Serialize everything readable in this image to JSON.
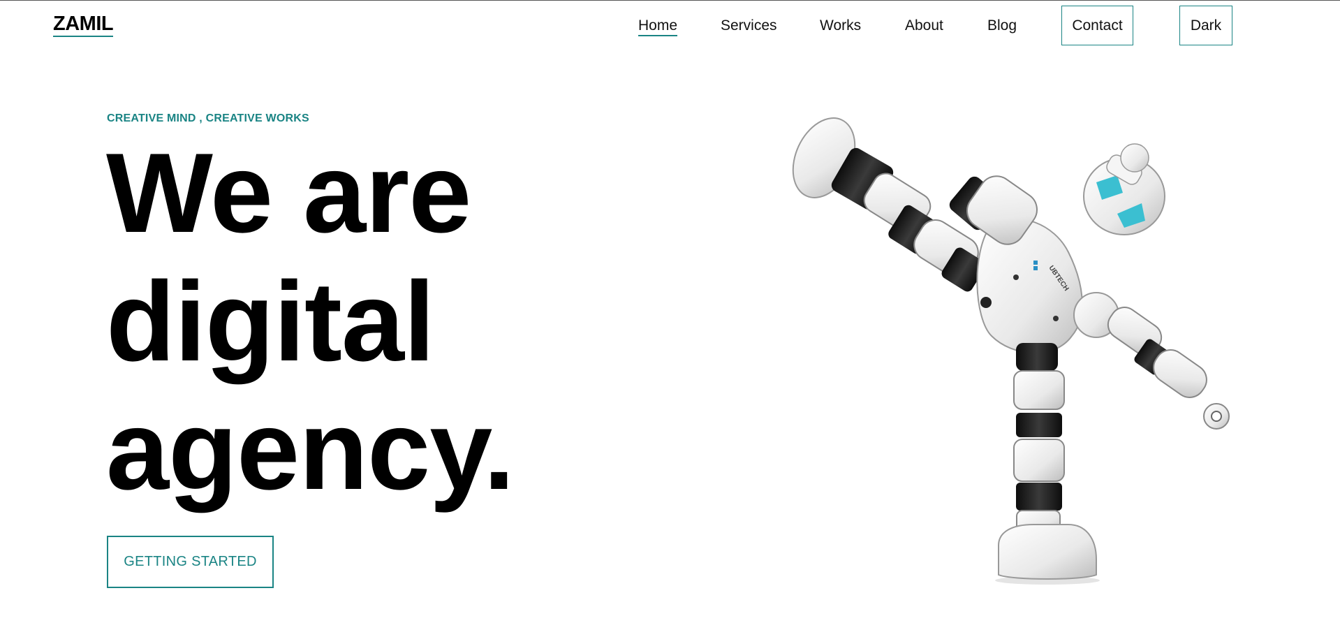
{
  "header": {
    "logo": "ZAMIL",
    "nav": [
      {
        "label": "Home",
        "active": true
      },
      {
        "label": "Services"
      },
      {
        "label": "Works"
      },
      {
        "label": "About"
      },
      {
        "label": "Blog"
      }
    ],
    "contact_label": "Contact",
    "theme_toggle_label": "Dark"
  },
  "hero": {
    "eyebrow": "CREATIVE MIND , CREATIVE WORKS",
    "title_lines": [
      "We are",
      "digital",
      "agency."
    ],
    "cta_label": "GETTING STARTED",
    "robot_brand": "UBTECH"
  },
  "colors": {
    "accent": "#1a8484",
    "background": "#ffffff",
    "text": "#000000",
    "robot_eye": "#3bbfd1"
  }
}
